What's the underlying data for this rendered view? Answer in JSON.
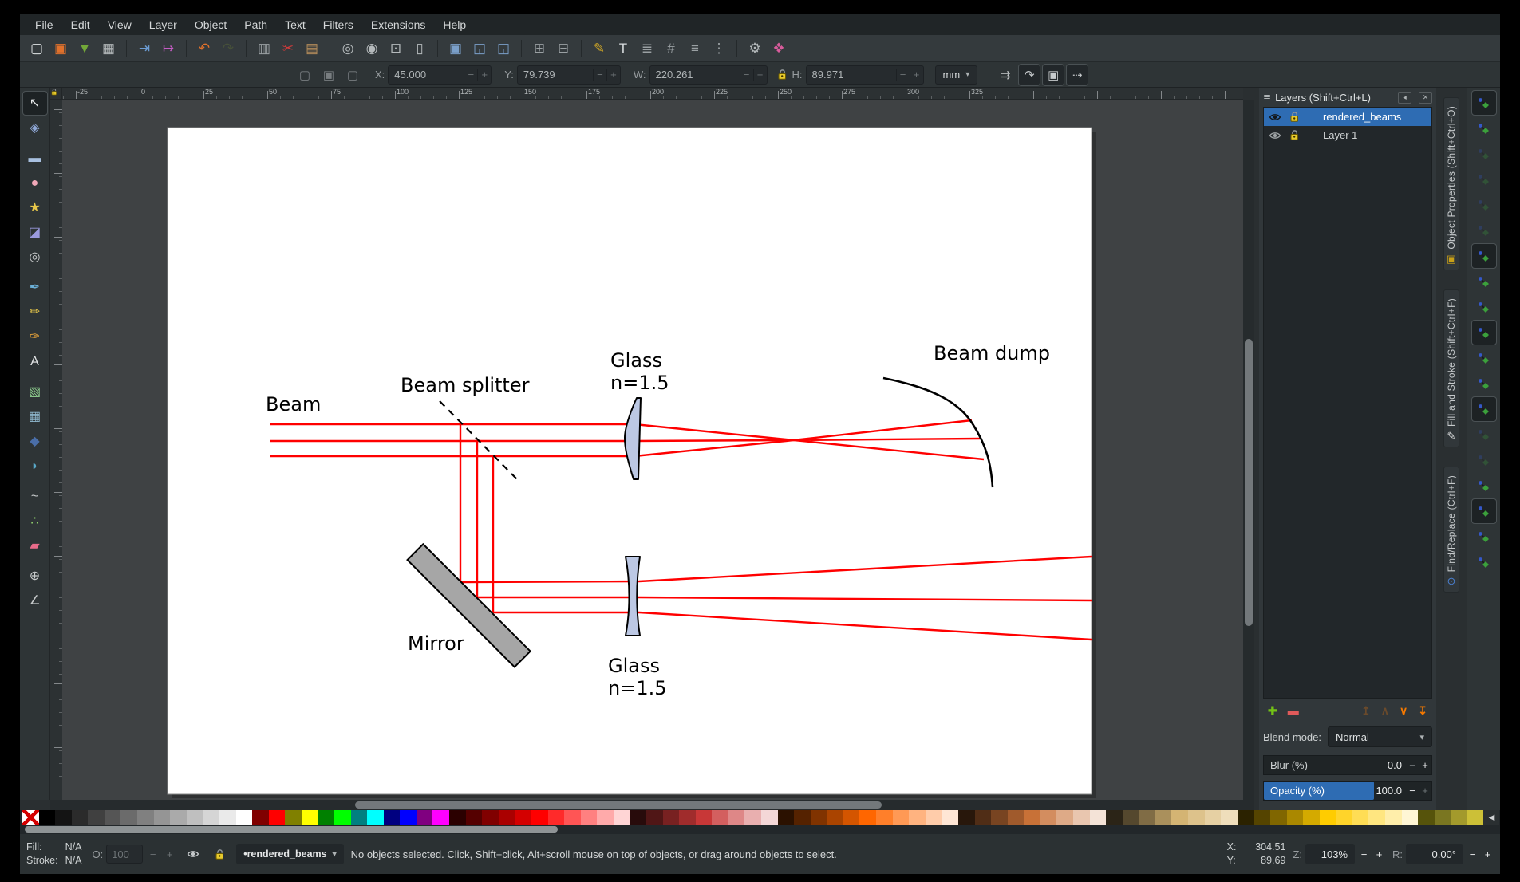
{
  "menu": [
    "File",
    "Edit",
    "View",
    "Layer",
    "Object",
    "Path",
    "Text",
    "Filters",
    "Extensions",
    "Help"
  ],
  "toolbar_icons": [
    {
      "name": "document-new",
      "glyph": "▢",
      "color": "#dfe2e3"
    },
    {
      "name": "document-open",
      "glyph": "▣",
      "color": "#e0712c"
    },
    {
      "name": "document-save",
      "glyph": "▼",
      "color": "#73a839"
    },
    {
      "name": "document-print",
      "glyph": "▦",
      "color": "#aeb3b5"
    },
    {
      "sep": true
    },
    {
      "name": "document-import",
      "glyph": "⇥",
      "color": "#6b9bd2"
    },
    {
      "name": "document-export",
      "glyph": "↦",
      "color": "#c45cc4"
    },
    {
      "sep": true
    },
    {
      "name": "edit-undo",
      "glyph": "↶",
      "color": "#e0712c"
    },
    {
      "name": "edit-redo",
      "glyph": "↷",
      "color": "#5d6b35",
      "dim": true
    },
    {
      "sep": true
    },
    {
      "name": "edit-copy",
      "glyph": "▥",
      "color": "#9aa0a3"
    },
    {
      "name": "edit-cut",
      "glyph": "✂",
      "color": "#d23b3b"
    },
    {
      "name": "edit-paste",
      "glyph": "▤",
      "color": "#b08a5a"
    },
    {
      "sep": true
    },
    {
      "name": "zoom-selection",
      "glyph": "◎",
      "color": "#b5babc"
    },
    {
      "name": "zoom-drawing",
      "glyph": "◉",
      "color": "#b5babc"
    },
    {
      "name": "zoom-page",
      "glyph": "⊡",
      "color": "#b5babc"
    },
    {
      "name": "zoom-page-width",
      "glyph": "▯",
      "color": "#b5babc"
    },
    {
      "sep": true
    },
    {
      "name": "duplicate",
      "glyph": "▣",
      "color": "#7a9fc9"
    },
    {
      "name": "create-clone",
      "glyph": "◱",
      "color": "#7a9fc9"
    },
    {
      "name": "unlink-clone",
      "glyph": "◲",
      "color": "#7a9fc9"
    },
    {
      "sep": true
    },
    {
      "name": "group",
      "glyph": "⊞",
      "color": "#9aa0a3"
    },
    {
      "name": "ungroup",
      "glyph": "⊟",
      "color": "#9aa0a3"
    },
    {
      "sep": true
    },
    {
      "name": "open-fill-stroke",
      "glyph": "✎",
      "color": "#c9a227"
    },
    {
      "name": "open-text-dialog",
      "glyph": "T",
      "color": "#d8dcde"
    },
    {
      "name": "open-layers-dialog",
      "glyph": "≣",
      "color": "#9aa0a3"
    },
    {
      "name": "open-xml-editor",
      "glyph": "#",
      "color": "#9aa0a3"
    },
    {
      "name": "open-align-dialog",
      "glyph": "≡",
      "color": "#9aa0a3"
    },
    {
      "name": "rows-and-columns",
      "glyph": "⋮",
      "color": "#9aa0a3"
    },
    {
      "sep": true
    },
    {
      "name": "display-preferences",
      "glyph": "⚙",
      "color": "#b5babc"
    },
    {
      "name": "inkscape-preferences",
      "glyph": "❖",
      "color": "#d85c9c"
    }
  ],
  "tool_controls": {
    "helper_icons": [
      {
        "name": "select-all",
        "glyph": "▢"
      },
      {
        "name": "select-all-layers",
        "glyph": "▣"
      },
      {
        "name": "deselect",
        "glyph": "▢"
      }
    ],
    "fields": {
      "x": {
        "label": "X:",
        "value": "45.000"
      },
      "y": {
        "label": "Y:",
        "value": "79.739"
      },
      "w": {
        "label": "W:",
        "value": "220.261"
      },
      "h": {
        "label": "H:",
        "value": "89.971"
      }
    },
    "units": "mm",
    "affect_buttons": [
      {
        "name": "scale-stroke-toggle",
        "glyph": "⇉",
        "pressed": false
      },
      {
        "name": "scale-corners-toggle",
        "glyph": "↷",
        "pressed": true
      },
      {
        "name": "move-gradients-toggle",
        "glyph": "▣",
        "pressed": true
      },
      {
        "name": "move-patterns-toggle",
        "glyph": "⇢",
        "pressed": true
      }
    ]
  },
  "ruler": {
    "h_labels": [
      "-25",
      "0",
      "25",
      "50",
      "75",
      "100",
      "125",
      "150",
      "175",
      "200",
      "225",
      "250",
      "275",
      "300",
      "325"
    ]
  },
  "toolbox": [
    {
      "name": "selector-tool",
      "glyph": "↖",
      "color": "#e8eaeb",
      "active": true
    },
    {
      "name": "node-tool",
      "glyph": "◈",
      "color": "#8fa8d8"
    },
    {
      "sep": true
    },
    {
      "name": "rectangle-tool",
      "glyph": "▬",
      "color": "#a8c0e0"
    },
    {
      "name": "ellipse-tool",
      "glyph": "●",
      "color": "#f0a8b8"
    },
    {
      "name": "star-tool",
      "glyph": "★",
      "color": "#e8c84a"
    },
    {
      "name": "box3d-tool",
      "glyph": "◪",
      "color": "#9a9ade"
    },
    {
      "name": "spiral-tool",
      "glyph": "◎",
      "color": "#c8cbcc"
    },
    {
      "sep": true
    },
    {
      "name": "pen-tool",
      "glyph": "✒",
      "color": "#6bb0d8"
    },
    {
      "name": "pencil-tool",
      "glyph": "✏",
      "color": "#e8c84a"
    },
    {
      "name": "calligraphy-tool",
      "glyph": "✑",
      "color": "#e8a43a"
    },
    {
      "name": "text-tool",
      "glyph": "A",
      "color": "#e4e6e7"
    },
    {
      "sep": true
    },
    {
      "name": "gradient-tool",
      "glyph": "▧",
      "color": "#8fce8f"
    },
    {
      "name": "mesh-tool",
      "glyph": "▦",
      "color": "#8fb8ce"
    },
    {
      "name": "dropper-tool",
      "glyph": "◆",
      "color": "#4a6ea8"
    },
    {
      "name": "paint-bucket-tool",
      "glyph": "◗",
      "color": "#58a8c8"
    },
    {
      "sep": true
    },
    {
      "name": "tweak-tool",
      "glyph": "~",
      "color": "#c8cbcc"
    },
    {
      "name": "spray-tool",
      "glyph": "∴",
      "color": "#8fce6b"
    },
    {
      "name": "eraser-tool",
      "glyph": "▰",
      "color": "#e86b8a"
    },
    {
      "sep": true
    },
    {
      "name": "zoom-tool",
      "glyph": "⊕",
      "color": "#c8cbcc"
    },
    {
      "name": "measure-tool",
      "glyph": "∠",
      "color": "#c8cbcc"
    }
  ],
  "layers_panel": {
    "title": "Layers (Shift+Ctrl+L)",
    "layers": [
      {
        "name": "rendered_beams",
        "selected": true,
        "visible": true,
        "locked": false
      },
      {
        "name": "Layer 1",
        "selected": false,
        "visible": true,
        "locked": false
      }
    ],
    "buttons": [
      {
        "name": "add-layer",
        "glyph": "✚",
        "color": "#73c216"
      },
      {
        "name": "remove-layer",
        "glyph": "▬",
        "color": "#e05a5a"
      },
      {
        "spacer": true
      },
      {
        "name": "layer-to-top",
        "glyph": "↥",
        "color": "#9a5b1f",
        "dim": true
      },
      {
        "name": "raise-layer",
        "glyph": "∧",
        "color": "#9a5b1f",
        "dim": true
      },
      {
        "name": "lower-layer",
        "glyph": "∨",
        "color": "#f57900"
      },
      {
        "name": "layer-to-bottom",
        "glyph": "↧",
        "color": "#f57900"
      }
    ],
    "blend_mode_label": "Blend mode:",
    "blend_mode": "Normal",
    "blur_label": "Blur (%)",
    "blur_value": "0.0",
    "opacity_label": "Opacity (%)",
    "opacity_value": "100.0"
  },
  "dock_tabs": [
    {
      "name": "object-properties",
      "label": "Object Properties (Shift+Ctrl+O)",
      "glyph": "▣",
      "color": "#c8a018"
    },
    {
      "name": "fill-and-stroke",
      "label": "Fill and Stroke (Shift+Ctrl+F)",
      "glyph": "✎",
      "color": "#d8dadb"
    },
    {
      "name": "find-replace",
      "label": "Find/Replace (Ctrl+F)",
      "glyph": "⊙",
      "color": "#4a7fd0"
    }
  ],
  "snap_toolbar": [
    {
      "name": "snapping-enabled",
      "active": true
    },
    {
      "name": "snap-bbox",
      "active": false
    },
    {
      "name": "snap-bbox-edges",
      "faded": true
    },
    {
      "name": "snap-bbox-corners",
      "faded": true
    },
    {
      "name": "snap-bbox-edge-midpoints",
      "faded": true
    },
    {
      "name": "snap-bbox-centers",
      "faded": true
    },
    {
      "name": "snap-nodes",
      "active": true
    },
    {
      "name": "snap-paths",
      "active": false
    },
    {
      "name": "snap-path-intersections",
      "active": false
    },
    {
      "name": "snap-cusp-nodes",
      "active": true
    },
    {
      "name": "snap-smooth-nodes",
      "active": false
    },
    {
      "name": "snap-line-midpoints",
      "active": false
    },
    {
      "name": "snap-others",
      "active": true
    },
    {
      "name": "snap-object-centers",
      "faded": true
    },
    {
      "name": "snap-rotation-centers",
      "faded": true
    },
    {
      "name": "snap-text-baselines",
      "active": false
    },
    {
      "name": "snap-page-border",
      "active": true
    },
    {
      "name": "snap-grids",
      "active": false
    },
    {
      "name": "snap-guides",
      "active": false
    }
  ],
  "palette": {
    "colors": [
      "none",
      "#000000",
      "#141414",
      "#2b2b2b",
      "#404040",
      "#555555",
      "#6b6b6b",
      "#808080",
      "#959595",
      "#aaaaaa",
      "#bfbfbf",
      "#d5d5d5",
      "#eaeaea",
      "#ffffff",
      "#800000",
      "#ff0000",
      "#808000",
      "#ffff00",
      "#008000",
      "#00ff00",
      "#008080",
      "#00ffff",
      "#000080",
      "#0000ff",
      "#800080",
      "#ff00ff",
      "#2b0000",
      "#550000",
      "#800000",
      "#aa0000",
      "#d40000",
      "#ff0000",
      "#ff2a2a",
      "#ff5555",
      "#ff8080",
      "#ffaaaa",
      "#ffd5d5",
      "#280b0b",
      "#501616",
      "#782121",
      "#a02c2c",
      "#c83737",
      "#d35f5f",
      "#de8787",
      "#e9afaf",
      "#f4d7d7",
      "#2b1100",
      "#552200",
      "#803300",
      "#aa4400",
      "#d45500",
      "#ff6600",
      "#ff7f2a",
      "#ff9955",
      "#ffb380",
      "#ffccaa",
      "#ffe6d5",
      "#28170b",
      "#502d16",
      "#784421",
      "#a05a2c",
      "#c87137",
      "#d38d5f",
      "#deaa87",
      "#e9c6af",
      "#f4e3d7",
      "#2b2417",
      "#55482e",
      "#806c45",
      "#aa905c",
      "#d4b473",
      "#ddc28b",
      "#e6d0a3",
      "#efdebb",
      "#2b2200",
      "#554400",
      "#806600",
      "#aa8800",
      "#d4aa00",
      "#ffcc00",
      "#ffd42a",
      "#ffdd55",
      "#ffe680",
      "#ffeeaa",
      "#fff6d5",
      "#56530b",
      "#7a7621",
      "#a39a2c",
      "#ccc037"
    ]
  },
  "status_bar": {
    "fill_label": "Fill:",
    "fill_value": "N/A",
    "stroke_label": "Stroke:",
    "stroke_value": "N/A",
    "opacity_label": "O:",
    "opacity_value": "100",
    "layer_indicator": "•rendered_beams",
    "message": "No objects selected. Click, Shift+click, Alt+scroll mouse on top of objects, or drag around objects to select.",
    "x_label": "X:",
    "x_value": "304.51",
    "y_label": "Y:",
    "y_value": "89.69",
    "zoom_label": "Z:",
    "zoom_value": "103%",
    "rotation_label": "R:",
    "rotation_value": "0.00°"
  },
  "ui_icons": {
    "dropdown_caret": "▾",
    "palette_prev": "◀",
    "minus": "−",
    "plus": "+",
    "shade": "◂",
    "close": "✕",
    "layers_glyph": "≣"
  },
  "diagram": {
    "labels": {
      "beam": "Beam",
      "beam_splitter": "Beam splitter",
      "glass_top_1": "Glass",
      "glass_top_2": "n=1.5",
      "beam_dump": "Beam dump",
      "mirror": "Mirror",
      "glass_bottom_1": "Glass",
      "glass_bottom_2": "n=1.5"
    },
    "beam_color": "#ff0000",
    "lens_fill": "#bcc8e4",
    "mirror_fill": "#a6a6a6",
    "splitter_color": "#000000"
  }
}
